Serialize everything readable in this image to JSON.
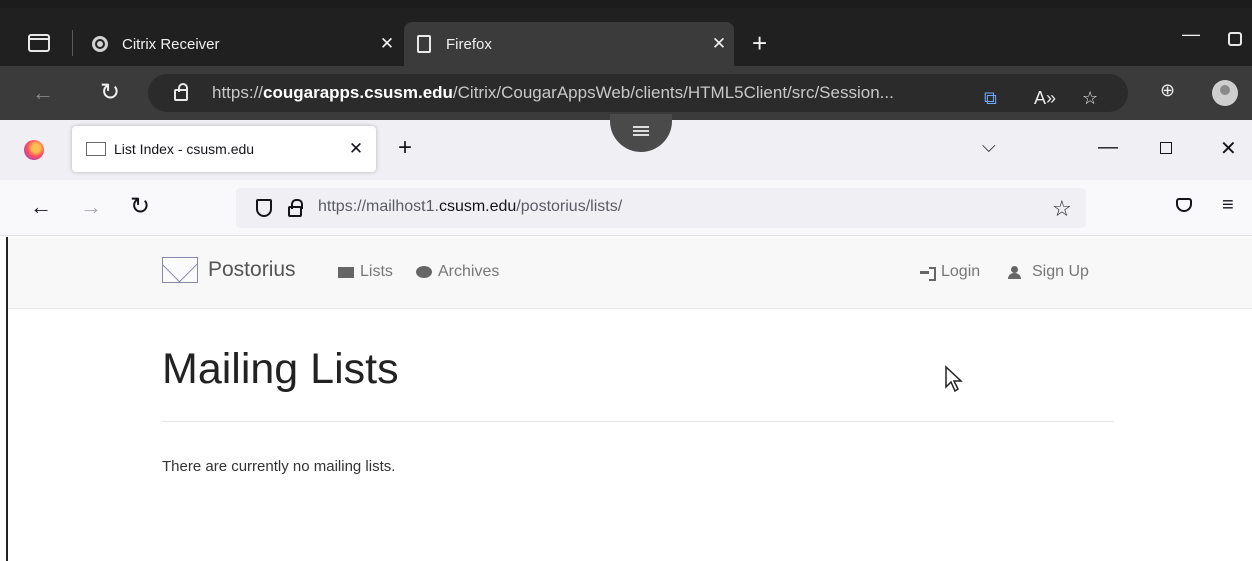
{
  "edge": {
    "tabs": [
      {
        "title": "Citrix Receiver",
        "icon": "citrix-icon",
        "close": "✕"
      },
      {
        "title": "Firefox",
        "icon": "page-icon",
        "close": "✕"
      }
    ],
    "new_tab": "+",
    "url_scheme": "https://",
    "url_host": "cougarapps.csusm.edu",
    "url_path": "/Citrix/CougarAppsWeb/clients/HTML5Client/src/Session...",
    "window_minimize": "—"
  },
  "firefox": {
    "tab": {
      "title": "List Index - csusm.edu",
      "close": "✕"
    },
    "new_tab": "+",
    "url_scheme": "https://mailhost1.",
    "url_host": "csusm.edu",
    "url_path": "/postorius/lists/",
    "window_minimize": "—",
    "window_close": "✕"
  },
  "navbar": {
    "brand": "Postorius",
    "lists": "Lists",
    "archives": "Archives",
    "login": "Login",
    "signup": "Sign Up"
  },
  "main": {
    "title": "Mailing Lists",
    "empty_message": "There are currently no mailing lists."
  },
  "colors": {
    "edge_tabbar": "#202020",
    "edge_toolbar": "#3b3b3b",
    "firefox_tabbar": "#f0f0f4",
    "navbar_bg": "#f8f8f8"
  }
}
